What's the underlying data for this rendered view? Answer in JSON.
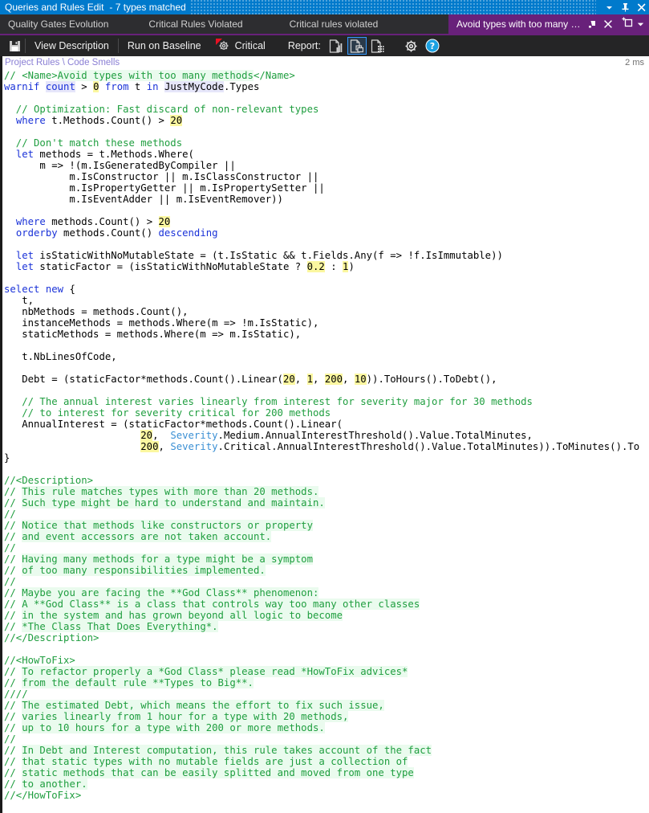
{
  "titlebar": {
    "title": "Queries and Rules Edit",
    "subtitle": "- 7 types matched",
    "dropdown_icon": "chevron-down-icon",
    "pin_icon": "pin-icon",
    "close_icon": "close-icon",
    "background": "#007acc"
  },
  "tabs": {
    "items": [
      {
        "label": "Quality Gates Evolution",
        "active": false
      },
      {
        "label": "Critical Rules Violated",
        "active": false
      },
      {
        "label": "Critical rules violated",
        "active": false
      }
    ],
    "active_tab": {
      "label": "Avoid types with too many m...",
      "pin_icon": "pin-icon",
      "close_icon": "close-icon"
    },
    "new_tab": {
      "icon": "new-tab-icon",
      "dropdown_icon": "chevron-down-icon"
    },
    "accent_color": "#68217a"
  },
  "toolbar": {
    "save_icon": "save-icon",
    "view_description_label": "View Description",
    "run_on_baseline_label": "Run on Baseline",
    "severity": {
      "label": "Critical",
      "icon": "critical-gear-icon",
      "marker_color": "#e81123"
    },
    "report_label": "Report:",
    "report_icons": [
      {
        "name": "report-chart-icon",
        "selected": false
      },
      {
        "name": "report-pages-icon",
        "selected": true
      },
      {
        "name": "report-table-icon",
        "selected": false
      }
    ],
    "settings_icon": "gear-icon",
    "help_icon": "help-icon",
    "help_color": "#1ba1e2"
  },
  "breadcrumb": {
    "text": "Project Rules \\ Code Smells",
    "elapsed": "2 ms",
    "color": "#8a7fd4"
  },
  "editor": {
    "language": "CQLinq",
    "colors": {
      "comment": "#1f9e3f",
      "keyword": "#1a32d8",
      "type": "#3a8fd4",
      "literal_highlight": "#fbf7a0",
      "identifier_highlight": "#e6e6fa",
      "comment_highlight": "#eafbee",
      "background": "#ffffff",
      "foreground": "#000000"
    },
    "lines": [
      [
        {
          "t": "// <Name>",
          "c": "cm"
        },
        {
          "t": "Avoid types with too many methods",
          "c": "cmh"
        },
        {
          "t": "</Name>",
          "c": "cm"
        }
      ],
      [
        {
          "t": "warnif ",
          "c": "kw"
        },
        {
          "t": "count",
          "c": "kwh"
        },
        {
          "t": " > ",
          "c": ""
        },
        {
          "t": "0",
          "c": "num"
        },
        {
          "t": " ",
          "c": ""
        },
        {
          "t": "from",
          "c": "kw"
        },
        {
          "t": " t ",
          "c": ""
        },
        {
          "t": "in",
          "c": "kw"
        },
        {
          "t": " ",
          "c": ""
        },
        {
          "t": "JustMyCode",
          "c": "idh"
        },
        {
          "t": ".Types",
          "c": ""
        }
      ],
      [
        {
          "t": "",
          "c": ""
        }
      ],
      [
        {
          "t": "  // Optimization: Fast discard of non-relevant types",
          "c": "cm"
        }
      ],
      [
        {
          "t": "  ",
          "c": ""
        },
        {
          "t": "where",
          "c": "kw"
        },
        {
          "t": " t.Methods.Count() > ",
          "c": ""
        },
        {
          "t": "20",
          "c": "num"
        }
      ],
      [
        {
          "t": "",
          "c": ""
        }
      ],
      [
        {
          "t": "  // Don't match these methods",
          "c": "cm"
        }
      ],
      [
        {
          "t": "  ",
          "c": ""
        },
        {
          "t": "let",
          "c": "kw"
        },
        {
          "t": " methods = t.Methods.Where(",
          "c": ""
        }
      ],
      [
        {
          "t": "      m => !(m.IsGeneratedByCompiler ||",
          "c": ""
        }
      ],
      [
        {
          "t": "           m.IsConstructor || m.IsClassConstructor ||",
          "c": ""
        }
      ],
      [
        {
          "t": "           m.IsPropertyGetter || m.IsPropertySetter ||",
          "c": ""
        }
      ],
      [
        {
          "t": "           m.IsEventAdder || m.IsEventRemover))",
          "c": ""
        }
      ],
      [
        {
          "t": "",
          "c": ""
        }
      ],
      [
        {
          "t": "  ",
          "c": ""
        },
        {
          "t": "where",
          "c": "kw"
        },
        {
          "t": " methods.Count() > ",
          "c": ""
        },
        {
          "t": "20",
          "c": "num"
        }
      ],
      [
        {
          "t": "  ",
          "c": ""
        },
        {
          "t": "orderby",
          "c": "kw"
        },
        {
          "t": " methods.Count() ",
          "c": ""
        },
        {
          "t": "descending",
          "c": "kw"
        }
      ],
      [
        {
          "t": "",
          "c": ""
        }
      ],
      [
        {
          "t": "  ",
          "c": ""
        },
        {
          "t": "let",
          "c": "kw"
        },
        {
          "t": " isStaticWithNoMutableState = (t.IsStatic && t.Fields.Any(f => !f.IsImmutable))",
          "c": ""
        }
      ],
      [
        {
          "t": "  ",
          "c": ""
        },
        {
          "t": "let",
          "c": "kw"
        },
        {
          "t": " staticFactor = (isStaticWithNoMutableState ? ",
          "c": ""
        },
        {
          "t": "0.2",
          "c": "num"
        },
        {
          "t": " : ",
          "c": ""
        },
        {
          "t": "1",
          "c": "num"
        },
        {
          "t": ")",
          "c": ""
        }
      ],
      [
        {
          "t": "",
          "c": ""
        }
      ],
      [
        {
          "t": "select",
          "c": "kw"
        },
        {
          "t": " ",
          "c": ""
        },
        {
          "t": "new",
          "c": "kw"
        },
        {
          "t": " {",
          "c": ""
        }
      ],
      [
        {
          "t": "   t,",
          "c": ""
        }
      ],
      [
        {
          "t": "   nbMethods = methods.Count(),",
          "c": ""
        }
      ],
      [
        {
          "t": "   instanceMethods = methods.Where(m => !m.IsStatic),",
          "c": ""
        }
      ],
      [
        {
          "t": "   staticMethods = methods.Where(m => m.IsStatic),",
          "c": ""
        }
      ],
      [
        {
          "t": "",
          "c": ""
        }
      ],
      [
        {
          "t": "   t.NbLinesOfCode,",
          "c": ""
        }
      ],
      [
        {
          "t": "",
          "c": ""
        }
      ],
      [
        {
          "t": "   Debt = (staticFactor*methods.Count().Linear(",
          "c": ""
        },
        {
          "t": "20",
          "c": "num"
        },
        {
          "t": ", ",
          "c": ""
        },
        {
          "t": "1",
          "c": "num"
        },
        {
          "t": ", ",
          "c": ""
        },
        {
          "t": "200",
          "c": "num"
        },
        {
          "t": ", ",
          "c": ""
        },
        {
          "t": "10",
          "c": "num"
        },
        {
          "t": ")).ToHours().ToDebt(),",
          "c": ""
        }
      ],
      [
        {
          "t": "",
          "c": ""
        }
      ],
      [
        {
          "t": "   // The annual interest varies linearly from interest for severity major for 30 methods",
          "c": "cm"
        }
      ],
      [
        {
          "t": "   // to interest for severity critical for 200 methods",
          "c": "cm"
        }
      ],
      [
        {
          "t": "   AnnualInterest = (staticFactor*methods.Count().Linear(",
          "c": ""
        }
      ],
      [
        {
          "t": "                       ",
          "c": ""
        },
        {
          "t": "20",
          "c": "num"
        },
        {
          "t": ",  ",
          "c": ""
        },
        {
          "t": "Severity",
          "c": "typ"
        },
        {
          "t": ".Medium.AnnualInterestThreshold().Value.TotalMinutes,",
          "c": ""
        }
      ],
      [
        {
          "t": "                       ",
          "c": ""
        },
        {
          "t": "200",
          "c": "num"
        },
        {
          "t": ", ",
          "c": ""
        },
        {
          "t": "Severity",
          "c": "typ"
        },
        {
          "t": ".Critical.AnnualInterestThreshold().Value.TotalMinutes)).ToMinutes().To",
          "c": ""
        }
      ],
      [
        {
          "t": "}",
          "c": ""
        }
      ],
      [
        {
          "t": "",
          "c": ""
        }
      ],
      [
        {
          "t": "//<Description>",
          "c": "cm"
        }
      ],
      [
        {
          "t": "// ",
          "c": "cm"
        },
        {
          "t": "This rule matches types with more than 20 methods.",
          "c": "cmh"
        }
      ],
      [
        {
          "t": "// ",
          "c": "cm"
        },
        {
          "t": "Such type might be hard to understand and maintain.",
          "c": "cmh"
        }
      ],
      [
        {
          "t": "//",
          "c": "cm"
        }
      ],
      [
        {
          "t": "// ",
          "c": "cm"
        },
        {
          "t": "Notice that methods like constructors or property",
          "c": "cmh"
        }
      ],
      [
        {
          "t": "// ",
          "c": "cm"
        },
        {
          "t": "and event accessors are not taken account.",
          "c": "cmh"
        }
      ],
      [
        {
          "t": "//",
          "c": "cm"
        }
      ],
      [
        {
          "t": "// ",
          "c": "cm"
        },
        {
          "t": "Having many methods for a type might be a symptom",
          "c": "cmh"
        }
      ],
      [
        {
          "t": "// ",
          "c": "cm"
        },
        {
          "t": "of too many responsibilities implemented.",
          "c": "cmh"
        }
      ],
      [
        {
          "t": "//",
          "c": "cm"
        }
      ],
      [
        {
          "t": "// ",
          "c": "cm"
        },
        {
          "t": "Maybe you are facing the **God Class** phenomenon:",
          "c": "cmh"
        }
      ],
      [
        {
          "t": "// ",
          "c": "cm"
        },
        {
          "t": "A **God Class** is a class that controls way too many other classes",
          "c": "cmh"
        }
      ],
      [
        {
          "t": "// ",
          "c": "cm"
        },
        {
          "t": "in the system and has grown beyond all logic to become",
          "c": "cmh"
        }
      ],
      [
        {
          "t": "// ",
          "c": "cm"
        },
        {
          "t": "*The Class That Does Everything*.",
          "c": "cmh"
        }
      ],
      [
        {
          "t": "//</Description>",
          "c": "cm"
        }
      ],
      [
        {
          "t": "",
          "c": ""
        }
      ],
      [
        {
          "t": "//<HowToFix>",
          "c": "cm"
        }
      ],
      [
        {
          "t": "// ",
          "c": "cm"
        },
        {
          "t": "To refactor properly a *God Class* please read *HowToFix advices*",
          "c": "cmh"
        }
      ],
      [
        {
          "t": "// ",
          "c": "cm"
        },
        {
          "t": "from the default rule **Types to Big**.",
          "c": "cmh"
        }
      ],
      [
        {
          "t": "////",
          "c": "cm"
        }
      ],
      [
        {
          "t": "// ",
          "c": "cm"
        },
        {
          "t": "The estimated Debt, which means the effort to fix such issue,",
          "c": "cmh"
        }
      ],
      [
        {
          "t": "// ",
          "c": "cm"
        },
        {
          "t": "varies linearly from 1 hour for a type with 20 methods,",
          "c": "cmh"
        }
      ],
      [
        {
          "t": "// ",
          "c": "cm"
        },
        {
          "t": "up to 10 hours for a type with 200 or more methods.",
          "c": "cmh"
        }
      ],
      [
        {
          "t": "//",
          "c": "cm"
        }
      ],
      [
        {
          "t": "// ",
          "c": "cm"
        },
        {
          "t": "In Debt and Interest computation, this rule takes account of the fact",
          "c": "cmh"
        }
      ],
      [
        {
          "t": "// ",
          "c": "cm"
        },
        {
          "t": "that static types with no mutable fields are just a collection of",
          "c": "cmh"
        }
      ],
      [
        {
          "t": "// ",
          "c": "cm"
        },
        {
          "t": "static methods that can be easily splitted and moved from one type",
          "c": "cmh"
        }
      ],
      [
        {
          "t": "// ",
          "c": "cm"
        },
        {
          "t": "to another.",
          "c": "cmh"
        }
      ],
      [
        {
          "t": "//</HowToFix>",
          "c": "cm"
        }
      ]
    ]
  }
}
